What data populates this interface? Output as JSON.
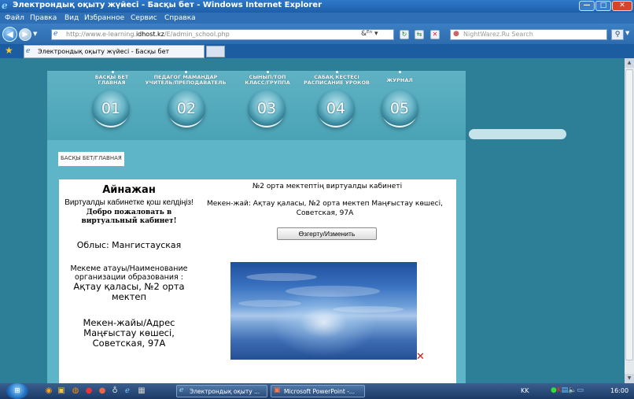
{
  "window": {
    "title": "Электрондық оқыту жүйесі - Басқы бет - Windows Internet Explorer",
    "minimize": "—",
    "maximize": "□",
    "close": "✕"
  },
  "menu": [
    "Файл",
    "Правка",
    "Вид",
    "Избранное",
    "Сервис",
    "Справка"
  ],
  "address": {
    "url_prefix": "http://www.e-learning.",
    "url_domain": "idhost.kz",
    "url_suffix": "/E/admin_school.php",
    "search_placeholder": "NightWarez.Ru Search"
  },
  "tabs": {
    "active": "Электрондық оқыту жүйесі - Басқы бет"
  },
  "nav": [
    {
      "kz": "БАСҚЫ БЕТ",
      "ru": "ГЛАВНАЯ",
      "num": "01"
    },
    {
      "kz": "ПЕДАГОГ МАМАНДАР",
      "ru": "УЧИТЕЛЬ/ПРЕПОДАВАТЕЛЬ",
      "num": "02"
    },
    {
      "kz": "СЫНЫП/ТОП",
      "ru": "КЛАСС/ГРУППА",
      "num": "03"
    },
    {
      "kz": "САБАҚ КЕСТЕСІ",
      "ru": "РАСПИСАНИЕ УРОКОВ",
      "num": "04"
    },
    {
      "kz": "ЖУРНАЛ",
      "ru": "",
      "num": "05"
    }
  ],
  "breadcrumb": "БАСҚЫ БЕТ/ГЛАВНАЯ",
  "profile": {
    "name": "Айнажан",
    "greet_kz": "Виртуалды кабинетке қош келдіңіз!",
    "greet_ru": "Добро пожаловать в виртуальный кабинет!",
    "region": "Облыс: Мангистауская",
    "org_label": "Мекеме атауы/Наименование организации образования :",
    "org_value": "Ақтау қаласы, №2 орта мектеп",
    "addr_label": "Мекен-жайы/Адрес Маңғыстау көшесі, Советская, 97А"
  },
  "school": {
    "cabinet": "№2 орта мектептің виртуалды кабинеті",
    "address": "Мекен-жай: Ақтау қаласы, №2 орта мектеп Маңғыстау көшесі, Советская, 97А",
    "edit_button": "Өзгерту/Изменить",
    "delete": "✕"
  },
  "taskbar": {
    "start": "⊞",
    "items": [
      {
        "label": "Электрондық оқыту ..."
      },
      {
        "label": "Microsoft PowerPoint -..."
      }
    ],
    "lang": "KK",
    "clock": "16:00"
  }
}
